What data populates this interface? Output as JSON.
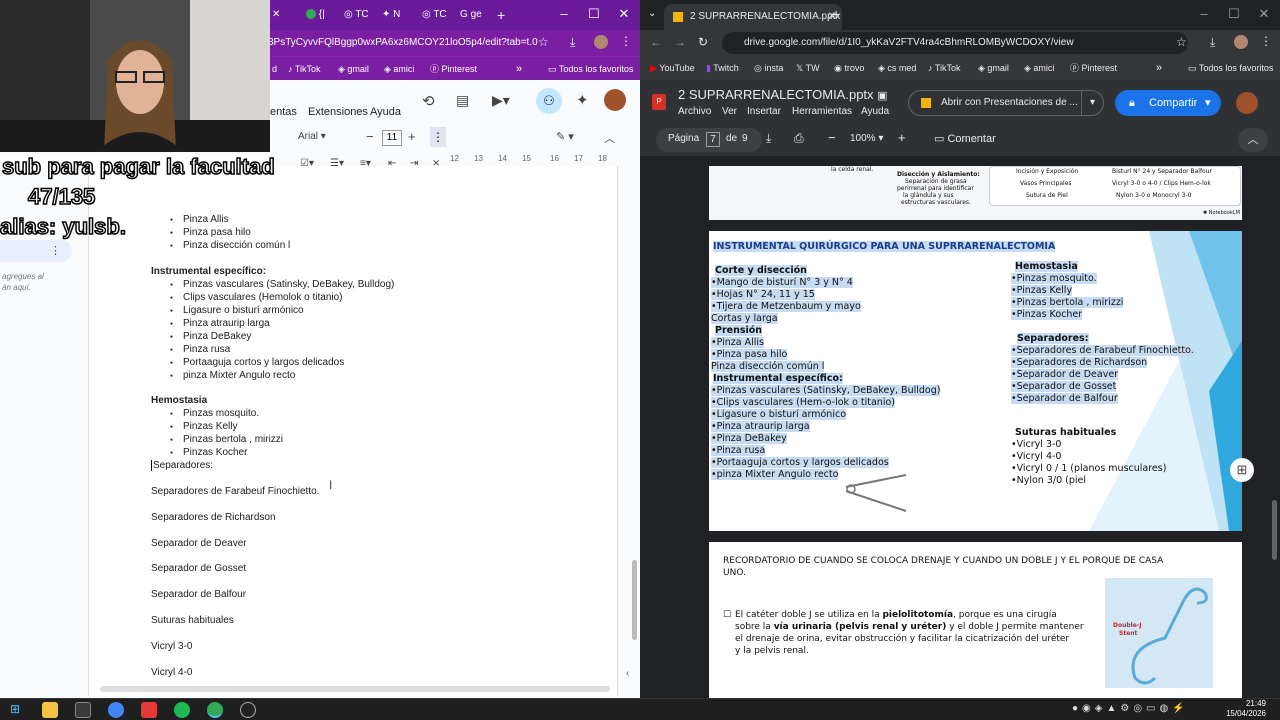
{
  "overlay": {
    "sub_line": "sub para pagar la facultad",
    "counter": "47/135",
    "alias": "alias: yulsb."
  },
  "left_browser": {
    "tabs": [
      "{|",
      "TC",
      "N",
      "TC",
      "ge"
    ],
    "url": "3PsTyCyvvFQlBggp0wxPA6xz6MCOY21loO5p4/edit?tab=t.0",
    "bookmarks": [
      "d",
      "TikTok",
      "gmail",
      "amici",
      "Pinterest",
      "Todos los favoritos"
    ],
    "menu": [
      "entas",
      "Extensiones",
      "Ayuda"
    ],
    "font": "Arial",
    "font_size": "11",
    "ruler": [
      "12",
      "13",
      "14",
      "15",
      "16",
      "17",
      "18"
    ],
    "side_note_1": "agregues al",
    "side_note_2": "án aquí."
  },
  "doc": {
    "lines_top": [
      "Pinza Allis",
      "Pinza pasa hilo",
      "Pinza disección común l"
    ],
    "heading_especifico": "Instrumental específico:",
    "especifico": [
      "Pinzas vasculares (Satinsky, DeBakey, Bulldog)",
      "Clips vasculares (Hemolok o titanio)",
      "Ligasure o bisturí armónico",
      "Pinza atraurip larga",
      "Pinza DeBakey",
      "Pinza rusa",
      "Portaaguja cortos y largos delicados",
      "pinza Mixter Angulo recto"
    ],
    "heading_hemostasia": "Hemostasia",
    "hemostasia": [
      "Pinzas mosquito.",
      "Pinzas Kelly",
      "Pinzas bertola , mirizzi",
      "Pinzas Kocher"
    ],
    "separadores_label": "Separadores:",
    "plain": [
      "Separadores de Farabeuf Finochietto.",
      "Separadores de Richardson",
      "Separador de Deaver",
      "Separador de Gosset",
      "Separador de Balfour",
      "Suturas habituales",
      "Vicryl 3-0",
      "Vicryl 4-0"
    ]
  },
  "right_browser": {
    "tab_title": "2 SUPRARRENALECTOMIA.pptx",
    "url": "drive.google.com/file/d/1I0_ykKaV2FTV4ra4cBhmRLOMByWCDOXY/view",
    "bookmarks": [
      "YouTube",
      "Twitch",
      "insta",
      "TW",
      "trovo",
      "cs med",
      "TikTok",
      "gmail",
      "amici",
      "Pinterest",
      "Todos los favoritos"
    ],
    "file_name": "2 SUPRARRENALECTOMIA.pptx",
    "menu": [
      "Archivo",
      "Ver",
      "Insertar",
      "Herramientas",
      "Ayuda"
    ],
    "open_with": "Abrir con Presentaciones de ...",
    "share": "Compartir",
    "page_label": "Página",
    "page_current": "7",
    "page_of": "de",
    "page_total": "9",
    "zoom": "100%",
    "comment": "Comentar"
  },
  "slide_top": {
    "left_small": "la celda renal.",
    "diss_title": "Disección y Aislamiento:",
    "diss_text": [
      "Separación de grasa",
      "perirrenal para identificar",
      "la glándula y sus",
      "estructuras vasculares."
    ],
    "table": [
      [
        "Incisión y Exposición",
        "Bisturí N° 24 y Separador Balfour"
      ],
      [
        "Vasos Principales",
        "Vicryl 3-0 o 4-0 / Clips Hem-o-lok"
      ],
      [
        "Sutura de Piel",
        "Nylon 3-0 o Monocryl 3-0"
      ]
    ],
    "watermark": "NotebookLM"
  },
  "slide_main": {
    "title": "INSTRUMENTAL QUIRÚRGICO PARA UNA SUPRRARENALECTOMIA",
    "h_corte": "Corte y disección",
    "corte": [
      "•Mango de bisturí N° 3 y N° 4",
      "•Hojas N° 24, 11 y 15",
      "•Tijera de Metzenbaum y mayo",
      " Cortas y larga"
    ],
    "h_prension": "Prensión",
    "prension": [
      "•Pinza Allis",
      "•Pinza pasa hilo",
      " Pinza disección común l"
    ],
    "h_especifico": "Instrumental específico:",
    "especifico": [
      "•Pinzas vasculares (Satinsky, DeBakey, Bulldog)",
      "•Clips vasculares (Hem-o-lok o titanio)",
      "•Ligasure o bisturí armónico",
      "•Pinza atraurip larga",
      "•Pinza DeBakey",
      "•Pinza rusa",
      "•Portaaguja cortos y largos delicados",
      "•pinza Mixter Angulo recto"
    ],
    "h_hemostasia": "Hemostasia",
    "hemostasia": [
      "•Pinzas mosquito.",
      "•Pinzas Kelly",
      "•Pinzas bertola , mirizzi",
      "•Pinzas Kocher"
    ],
    "h_separadores": "Separadores:",
    "separadores": [
      "•Separadores de Farabeuf Finochietto.",
      "•Separadores de Richardson",
      "•Separador de Deaver",
      "•Separador de Gosset",
      "•Separador de Balfour"
    ],
    "h_suturas": "Suturas habituales",
    "suturas": [
      "•Vicryl 3-0",
      "•Vicryl 4-0",
      "•Vicryl 0 / 1 (planos musculares)",
      "•Nylon 3/0 (piel"
    ]
  },
  "slide_bottom": {
    "title_1": "RECORDATORIO DE CUANDO SE COLOCA DRENAJE Y CUANDO UN DOBLE J Y EL PORQUE DE CASA",
    "title_2": "UNO.",
    "p1_a": "El catéter doble J se utiliza en la ",
    "p1_b": "pielolitotomía",
    "p1_c": ", porque es una cirugía",
    "p2_a": "sobre la ",
    "p2_b": "vía urinaria (pelvis renal y uréter)",
    "p2_c": " y el doble J permite mantener",
    "p3": "el drenaje de orina, evitar obstrucción y facilitar la cicatrización del uréter",
    "p4": "y la pelvis renal.",
    "stent_label_1": "Double-J",
    "stent_label_2": "Stent"
  },
  "taskbar": {
    "time": "21:49",
    "date": "15/04/2026"
  },
  "colors": {
    "left_chrome": "#7b1fa2",
    "slide_title": "#1a3d8f",
    "highlight": "#c7dcf3",
    "share_blue": "#1a73e8"
  }
}
